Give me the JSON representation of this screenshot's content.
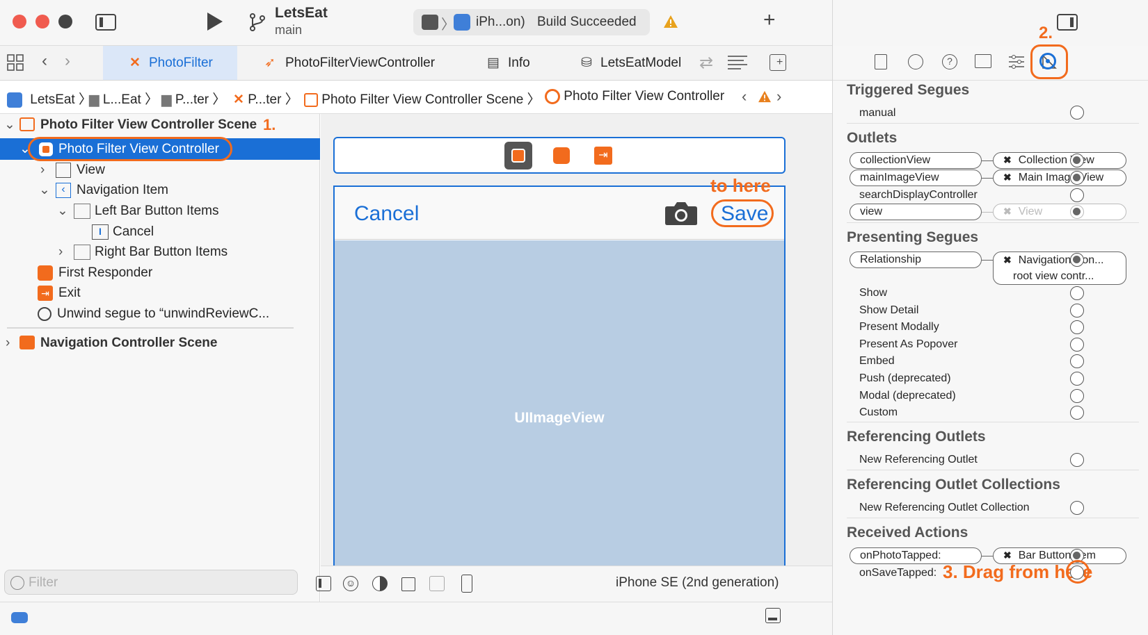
{
  "toolbar": {
    "project": "LetsEat",
    "branch": "main",
    "device": "iPh...on)",
    "build_status": "Build Succeeded"
  },
  "tabs": [
    {
      "label": "PhotoFilter"
    },
    {
      "label": "PhotoFilterViewController"
    },
    {
      "label": "Info"
    },
    {
      "label": "LetsEatModel"
    }
  ],
  "jumpbar": [
    "LetsEat",
    "L...Eat",
    "P...ter",
    "P...ter",
    "Photo Filter View Controller Scene",
    "Photo Filter View Controller"
  ],
  "navigator": {
    "scene1": "Photo Filter View Controller Scene",
    "step1": "1.",
    "vc": "Photo Filter View Controller",
    "view": "View",
    "navitem": "Navigation Item",
    "leftbar": "Left Bar Button Items",
    "cancel": "Cancel",
    "rightbar": "Right Bar Button Items",
    "first": "First Responder",
    "exit": "Exit",
    "unwind": "Unwind segue to “unwindReviewC...",
    "scene2": "Navigation Controller Scene",
    "filter_placeholder": "Filter"
  },
  "canvas": {
    "cancel": "Cancel",
    "save": "Save",
    "to_here": "to here",
    "imageview": "UIImageView",
    "device": "iPhone SE (2nd generation)"
  },
  "inspector": {
    "step2": "2.",
    "triggered": "Triggered Segues",
    "manual": "manual",
    "outlets": "Outlets",
    "outlet_rows": [
      {
        "name": "collectionView",
        "target": "Collection View",
        "connected": true
      },
      {
        "name": "mainImageView",
        "target": "Main Image View",
        "connected": true
      },
      {
        "name": "searchDisplayController",
        "target": "",
        "connected": false
      },
      {
        "name": "view",
        "target": "View",
        "connected": true,
        "dim": true
      }
    ],
    "presenting": "Presenting Segues",
    "relationship": "Relationship",
    "rel_target1": "Navigation Con...",
    "rel_target2": "root view contr...",
    "segues": [
      "Show",
      "Show Detail",
      "Present Modally",
      "Present As Popover",
      "Embed",
      "Push (deprecated)",
      "Modal (deprecated)",
      "Custom"
    ],
    "ref_outlets": "Referencing Outlets",
    "new_ref_outlet": "New Referencing Outlet",
    "ref_collections": "Referencing Outlet Collections",
    "new_ref_collection": "New Referencing Outlet Collection",
    "received": "Received Actions",
    "action1": "onPhotoTapped:",
    "action1_target": "Bar Button Item",
    "action2": "onSaveTapped:",
    "step3": "3. Drag from here"
  },
  "colors": {
    "accent": "#f26b1d",
    "selection": "#1a6fd6",
    "link": "#1a6fd6"
  }
}
